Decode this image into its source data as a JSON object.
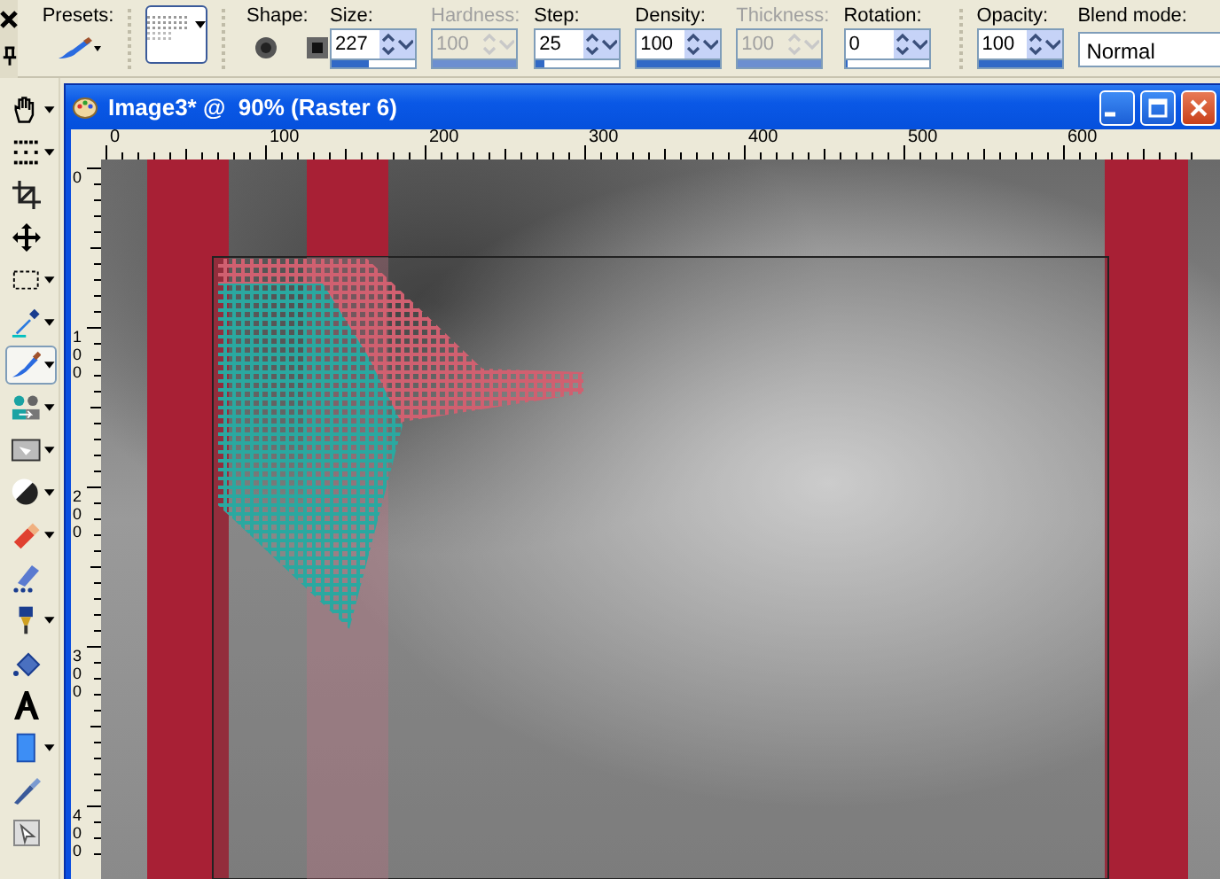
{
  "toolbar": {
    "presets": {
      "label": "Presets:"
    },
    "shape": {
      "label": "Shape:",
      "options": [
        {
          "kind": "round"
        },
        {
          "kind": "square"
        }
      ]
    },
    "fields": [
      {
        "label": "Size:",
        "value": "227",
        "disabled": false,
        "level": 0.45
      },
      {
        "label": "Hardness:",
        "value": "100",
        "disabled": true,
        "level": 1
      },
      {
        "label": "Step:",
        "value": "25",
        "disabled": false,
        "level": 0.1
      },
      {
        "label": "Density:",
        "value": "100",
        "disabled": false,
        "level": 1
      },
      {
        "label": "Thickness:",
        "value": "100",
        "disabled": true,
        "level": 1
      },
      {
        "label": "Rotation:",
        "value": "0",
        "disabled": false,
        "level": 0
      },
      {
        "label": "Opacity:",
        "value": "100",
        "disabled": false,
        "level": 1
      }
    ],
    "blend_mode": {
      "label": "Blend mode:",
      "value": "Normal"
    }
  },
  "tools": [
    {
      "kind": "hand",
      "selected": false,
      "dropdown": true
    },
    {
      "kind": "marquee",
      "selected": false,
      "dropdown": true
    },
    {
      "kind": "crop",
      "selected": false,
      "dropdown": false
    },
    {
      "kind": "move",
      "selected": false,
      "dropdown": false
    },
    {
      "kind": "selection",
      "selected": false,
      "dropdown": true
    },
    {
      "kind": "dropper",
      "selected": false,
      "dropdown": true
    },
    {
      "kind": "brush",
      "selected": true,
      "dropdown": true
    },
    {
      "kind": "stamp",
      "selected": false,
      "dropdown": true
    },
    {
      "kind": "picture",
      "selected": false,
      "dropdown": true
    },
    {
      "kind": "dodge",
      "selected": false,
      "dropdown": true
    },
    {
      "kind": "eraser",
      "selected": false,
      "dropdown": true
    },
    {
      "kind": "marker",
      "selected": false,
      "dropdown": false
    },
    {
      "kind": "tube",
      "selected": false,
      "dropdown": true
    },
    {
      "kind": "fill",
      "selected": false,
      "dropdown": false
    },
    {
      "kind": "text",
      "selected": false,
      "dropdown": false
    },
    {
      "kind": "shape",
      "selected": false,
      "dropdown": true
    },
    {
      "kind": "pen",
      "selected": false,
      "dropdown": false
    },
    {
      "kind": "deform",
      "selected": false,
      "dropdown": false
    }
  ],
  "window": {
    "title": "Image3* @  90% (Raster 6)"
  },
  "rulers": {
    "horizontal": [
      "0",
      "100",
      "200",
      "300",
      "400",
      "500",
      "600"
    ],
    "vertical": [
      "0",
      "100",
      "200",
      "300",
      "400"
    ]
  }
}
